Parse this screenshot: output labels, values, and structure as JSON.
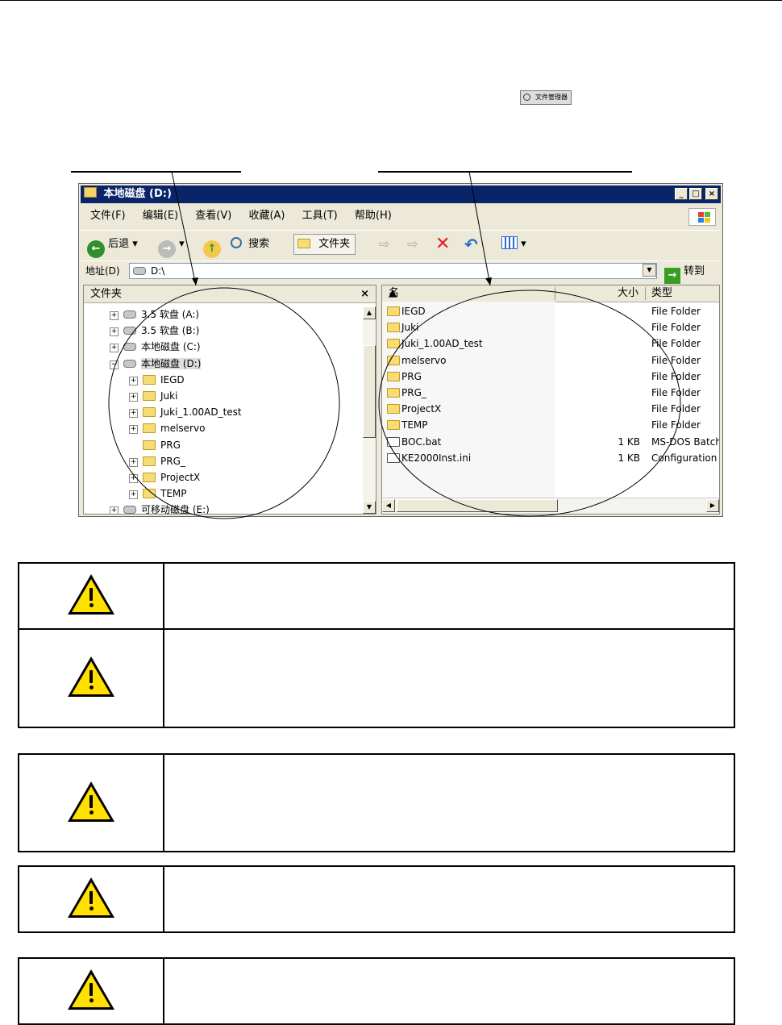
{
  "window": {
    "title": "本地磁盘 (D:)",
    "min_label": "_",
    "max_label": "□",
    "close_label": "×"
  },
  "menu": [
    "文件(F)",
    "编辑(E)",
    "查看(V)",
    "收藏(A)",
    "工具(T)",
    "帮助(H)"
  ],
  "toolbar": {
    "back_label": "后退",
    "search_label": "搜索",
    "folders_label": "文件夹"
  },
  "address": {
    "label": "地址(D)",
    "value": "D:\\",
    "go_label": "转到"
  },
  "left_pane": {
    "header": "文件夹",
    "close": "×",
    "tree": [
      {
        "label": "3.5 软盘 (A:)",
        "expander": "+"
      },
      {
        "label": "3.5 软盘 (B:)",
        "expander": "+"
      },
      {
        "label": "本地磁盘 (C:)",
        "expander": "+"
      },
      {
        "label": "本地磁盘 (D:)",
        "expander": "−",
        "selected": true
      },
      {
        "label": "IEGD",
        "expander": "+"
      },
      {
        "label": "Juki",
        "expander": "+"
      },
      {
        "label": "Juki_1.00AD_test",
        "expander": "+"
      },
      {
        "label": "melservo",
        "expander": "+"
      },
      {
        "label": "PRG",
        "expander": ""
      },
      {
        "label": "PRG_",
        "expander": "+"
      },
      {
        "label": "ProjectX",
        "expander": "+"
      },
      {
        "label": "TEMP",
        "expander": "+"
      },
      {
        "label": "可移动磁盘 (E:)",
        "expander": "+"
      }
    ]
  },
  "right_pane": {
    "columns": {
      "name": "名称",
      "size": "大小",
      "type": "类型"
    },
    "files": [
      {
        "name": "IEGD",
        "size": "",
        "type": "File Folder"
      },
      {
        "name": "Juki",
        "size": "",
        "type": "File Folder"
      },
      {
        "name": "Juki_1.00AD_test",
        "size": "",
        "type": "File Folder"
      },
      {
        "name": "melservo",
        "size": "",
        "type": "File Folder"
      },
      {
        "name": "PRG",
        "size": "",
        "type": "File Folder"
      },
      {
        "name": "PRG_",
        "size": "",
        "type": "File Folder"
      },
      {
        "name": "ProjectX",
        "size": "",
        "type": "File Folder"
      },
      {
        "name": "TEMP",
        "size": "",
        "type": "File Folder"
      },
      {
        "name": "BOC.bat",
        "size": "1 KB",
        "type": "MS-DOS Batch"
      },
      {
        "name": "KE2000Inst.ini",
        "size": "1 KB",
        "type": "Configuration"
      }
    ]
  },
  "small_button_label": "文件管理器",
  "warnings": [
    {
      "text": ""
    },
    {
      "text": ""
    },
    {
      "text": ""
    },
    {
      "text": ""
    },
    {
      "text": ""
    }
  ]
}
